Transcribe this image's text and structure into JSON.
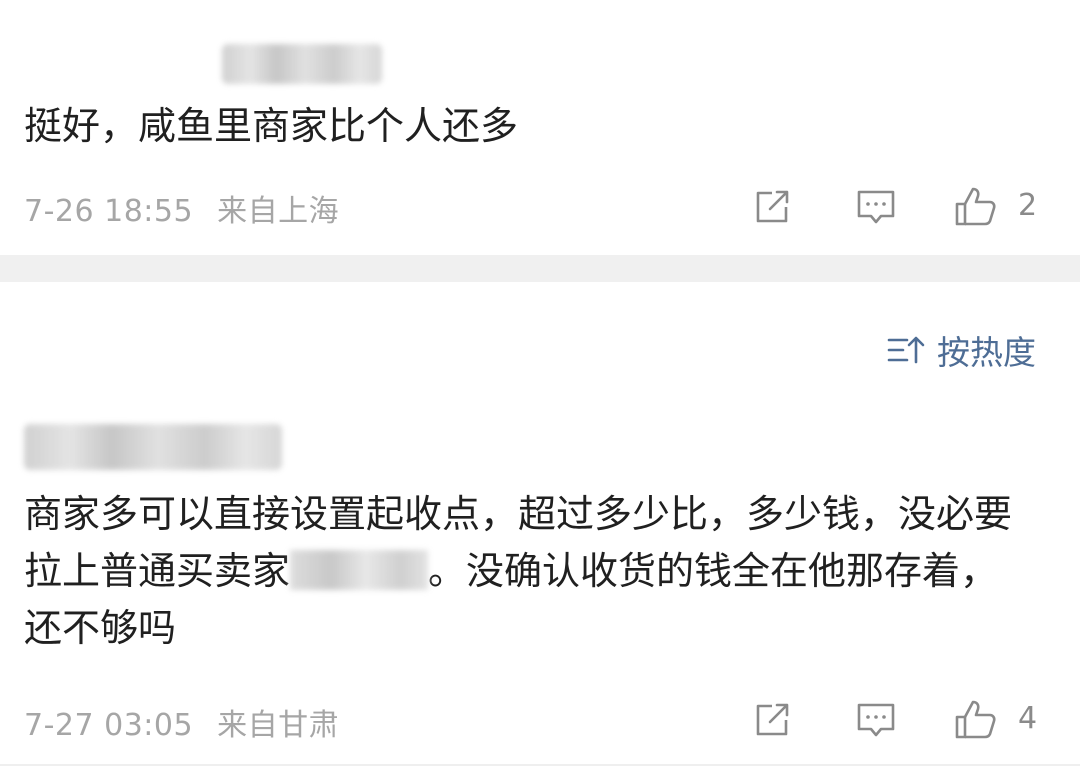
{
  "sort": {
    "label": "按热度",
    "icon": "sort-icon",
    "color": "#4e6d95"
  },
  "comments": [
    {
      "username": "",
      "text": "挺好，咸鱼里商家比个人还多",
      "date": "7-26 18:55",
      "location": "来自上海",
      "likes": "2"
    },
    {
      "username": "",
      "text_part1": "商家多可以直接设置起收点，超过多少比，多少钱，没必要拉上普通买卖家",
      "text_part2": "。没确认收货的钱全在他那存着，还不够吗",
      "date": "7-27 03:05",
      "location": "来自甘肃",
      "likes": "4"
    }
  ],
  "icons": {
    "share": "share-icon",
    "reply": "reply-icon",
    "like": "thumbs-up-icon"
  }
}
